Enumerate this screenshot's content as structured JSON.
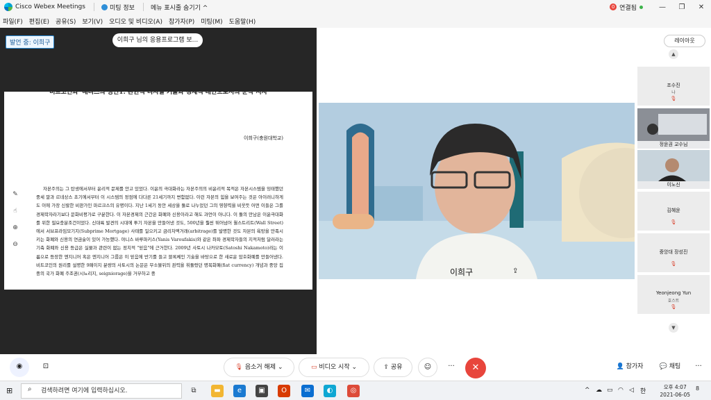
{
  "titlebar": {
    "app_title": "Cisco Webex Meetings",
    "meeting_info": "미팅 정보",
    "hide_menu": "메뉴 표시줄 숨기기 ^",
    "connection_count": "0",
    "connection_status": "연결됨"
  },
  "menu": [
    "파일(F)",
    "편집(E)",
    "공유(S)",
    "보기(V)",
    "오디오 및 비디오(A)",
    "참가자(P)",
    "미팅(M)",
    "도움말(H)"
  ],
  "share": {
    "speaking_label": "발언 중: 이희구",
    "app_share_pill": "이희구 님의 응용프로그램 보..."
  },
  "document": {
    "title": "비트코인과 '배디스의 성인1: 관한적 디지털 기술과 경제적 대안으로서의 순작 서사",
    "author": "이희구(충원대학교)",
    "body": "자본주의는 그 탄생에서부터 윤리적 문제를 안고 있었다. 이윤의 극대화라는 자본주의의 비윤리적 목적은 자본시스템을 잉태했던 중세 말과 르네상스 초기에서부터 이 시스템의 정점에 다다른 21세기까지 변함없다. 이런 자본의 힘을 보여주는 것은 아이러니하게도 이에 가장 신랄한 비판가인 마르크스의 유명이다. 지난 1세기 동안 세상을 둘로 나누었던 그의 영향력을 비웃듯 어떤 이들은 그를 경제학자라기보다 문화비평가로 구분한다. 이 자본경제의 근간은 화폐와 신용이라고 해도 과언이 아니다. 이 둘의 만남은 이윤극대화를 위한 필요충분조건이었다. 신대륙 발견의 시대에 투기 자본을 만들어낸 것도, 500년을 훨씬 뛰어넘어 월스트리트(Wall Street)에서 서브프라임모기지(Subprime Mortgage) 사태를 일으키고 금리차액거래(arbitrage)를 발명한 것도 자본의 욕망을 만족시키는 화폐와 신용의 연금술이 있어 가능했다. 야니스 바루파키스(Yanis Varoufakis)와 같은 좌파 경제학자들의 지적처럼 달러라는 기축 화폐와 신용 등급은 실물과 관련이 없는 정치적 \"믿음\"에 근거한다. 2009년 사토시 나카모토(Satoshi Nakamoto)라는 이름으로 등장한 엔지니어 혹은 엔지니어 그룹은 이 믿음에 반기를 들고 블록체인 기술을 바탕으로 한 새로운 암호화폐를 만들어낸다. 비트코인의 원리를 설명한 9페이지 분량의 사토시의 논문은 무소불위의 권력을 휘둘렀던 명목화폐(fiat currency) 개념과 중앙 집중의 국가 화폐 주조권(시뇨리지, seigniorage)을 거부하고 중"
  },
  "video": {
    "name": "이희구"
  },
  "layout_button": "레이아웃",
  "participants": [
    {
      "name": "조수진",
      "sub": "나",
      "video": false
    },
    {
      "name": "정윤권 교수님",
      "sub": "",
      "video": true
    },
    {
      "name": "이노신",
      "sub": "",
      "video": true
    },
    {
      "name": "김혜윤",
      "sub": "",
      "video": false
    },
    {
      "name": "중앙대 장성진",
      "sub": "",
      "video": false
    },
    {
      "name": "Yeonjeong Yun",
      "sub": "호스트",
      "video": false
    }
  ],
  "controls": {
    "mute": "음소거 해제",
    "video": "비디오 시작",
    "share": "공유",
    "participants": "참가자",
    "chat": "채팅"
  },
  "taskbar": {
    "search_placeholder": "검색하려면 여기에 입력하십시오.",
    "time": "오후 4:07",
    "date": "2021-06-05",
    "ime": "한",
    "notif": "8"
  }
}
